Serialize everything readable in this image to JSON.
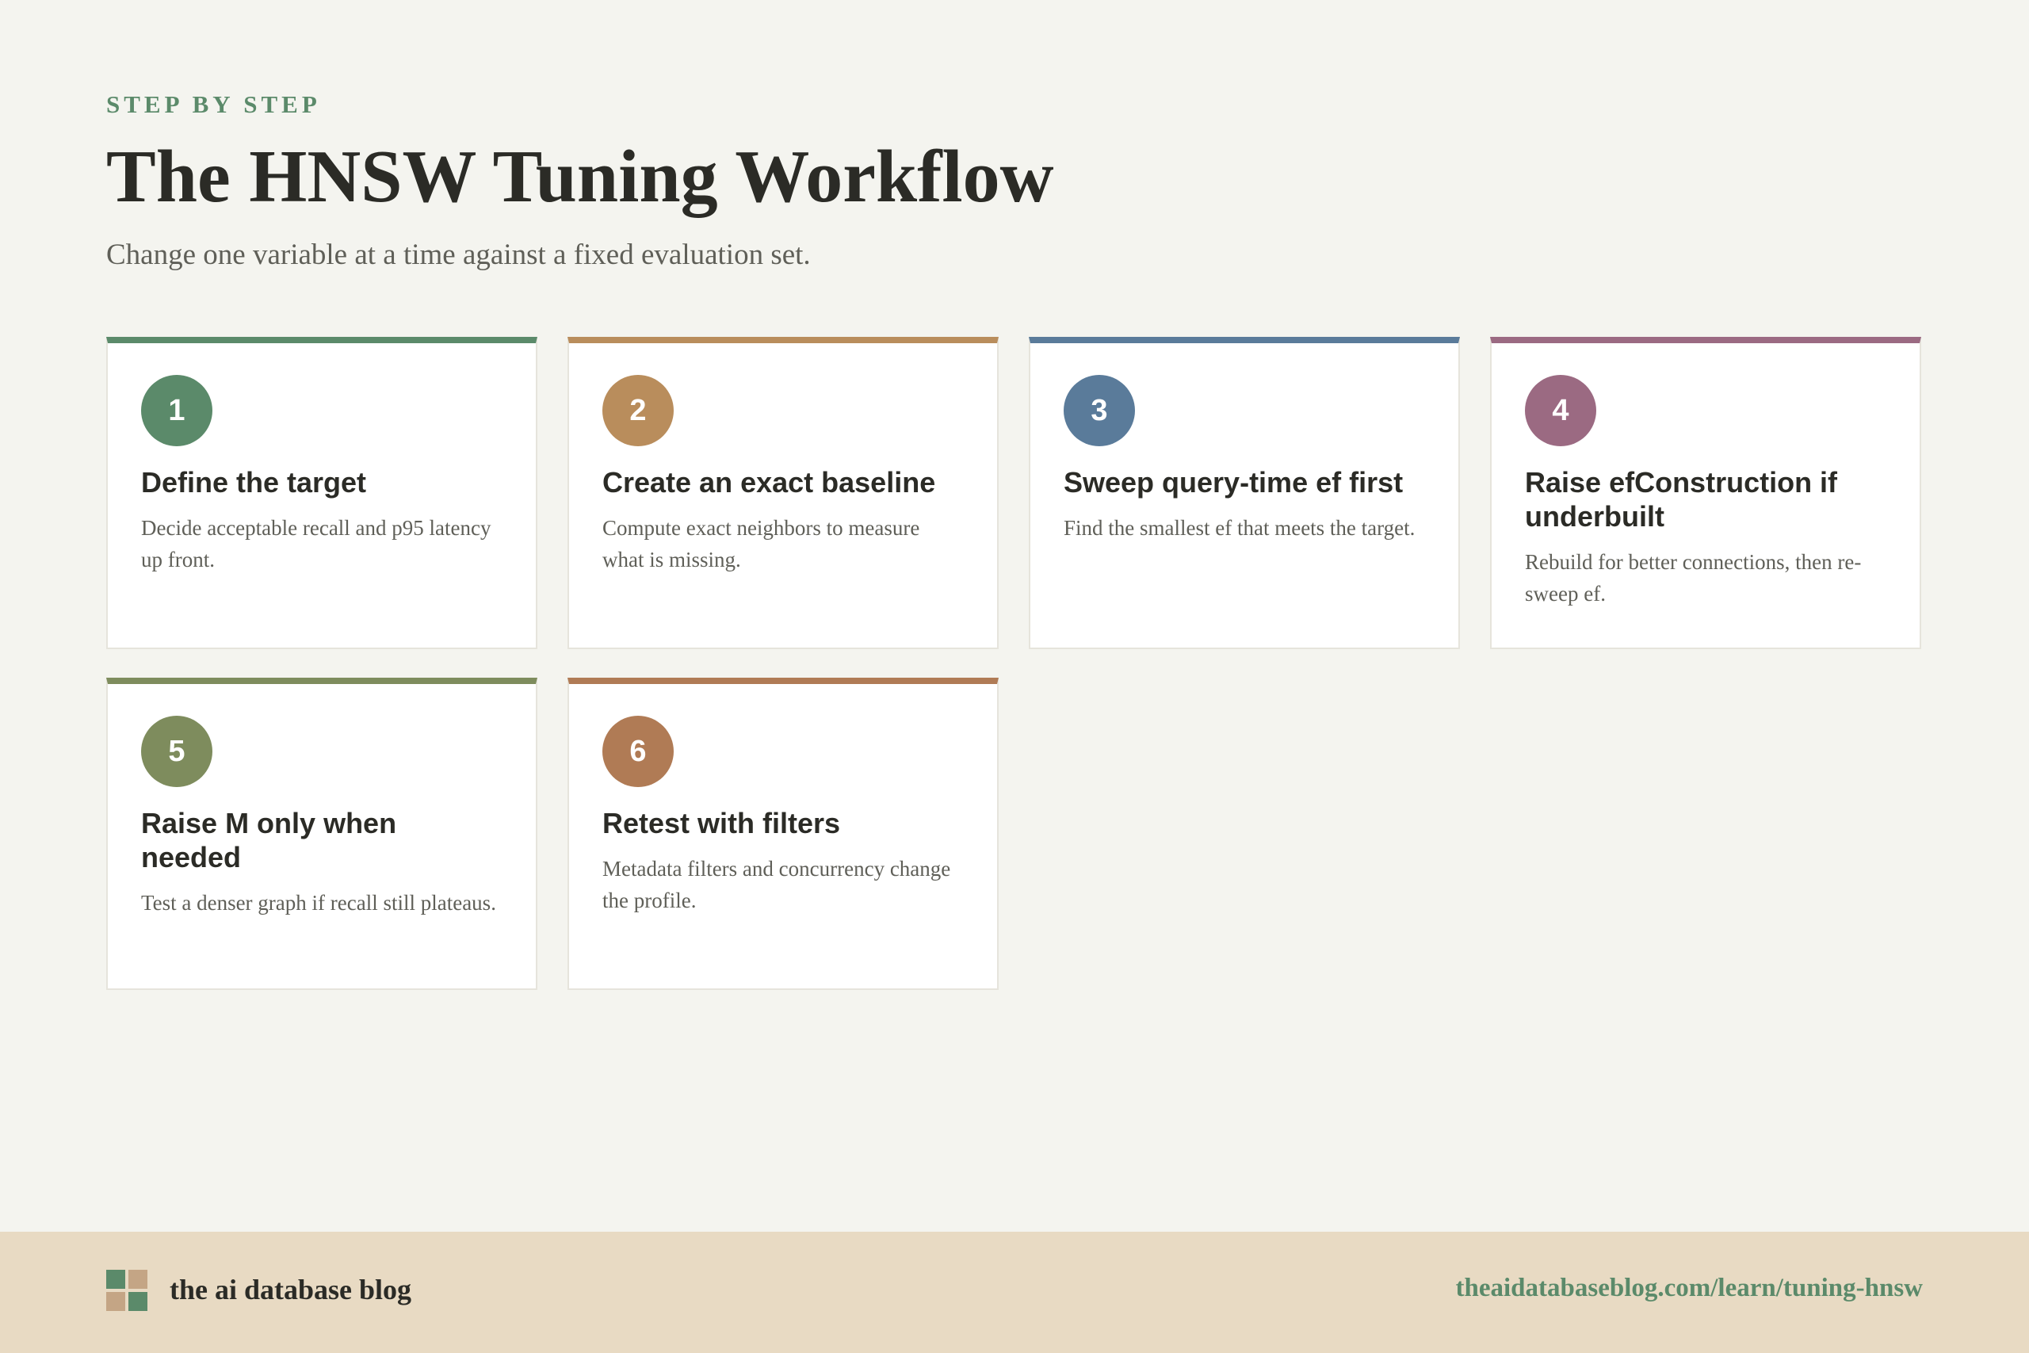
{
  "header": {
    "eyebrow": "STEP BY STEP",
    "title": "The HNSW Tuning Workflow",
    "subtitle": "Change one variable at a time against a fixed evaluation set."
  },
  "steps": [
    {
      "number": "1",
      "title": "Define the target",
      "description": "Decide acceptable recall and p95 latency up front.",
      "color": "#5b8a6a"
    },
    {
      "number": "2",
      "title": "Create an exact baseline",
      "description": "Compute exact neighbors to measure what is missing.",
      "color": "#b98d5c"
    },
    {
      "number": "3",
      "title": "Sweep query-time ef first",
      "description": "Find the smallest ef that meets the target.",
      "color": "#5a7b9a"
    },
    {
      "number": "4",
      "title": "Raise efConstruction if underbuilt",
      "description": "Rebuild for better connections, then re-sweep ef.",
      "color": "#9b6a82"
    },
    {
      "number": "5",
      "title": "Raise M only when needed",
      "description": "Test a denser graph if recall still plateaus.",
      "color": "#7e8c5d"
    },
    {
      "number": "6",
      "title": "Retest with filters",
      "description": "Metadata filters and concurrency change the profile.",
      "color": "#b07b55"
    }
  ],
  "footer": {
    "brand": "the ai database blog",
    "url": "theaidatabaseblog.com/learn/tuning-hnsw",
    "logo_colors": [
      "#5b8a6a",
      "#c4a585"
    ]
  }
}
